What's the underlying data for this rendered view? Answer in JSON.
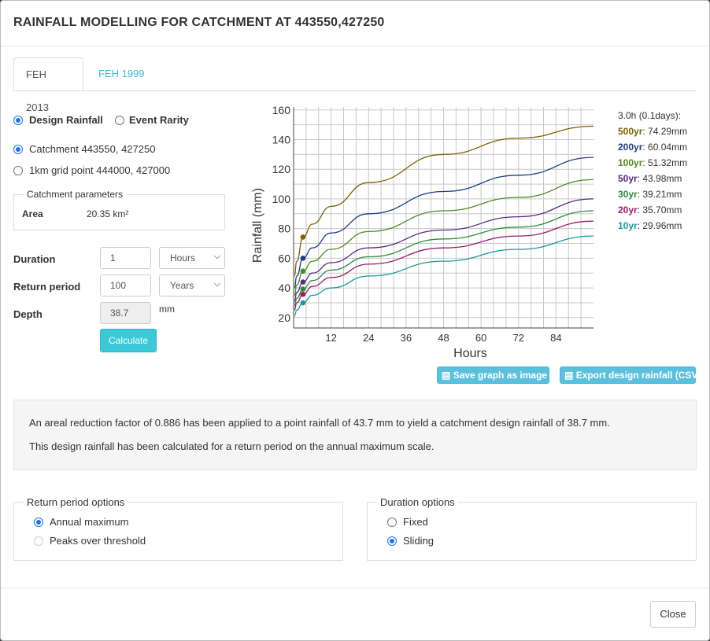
{
  "title": "RAINFALL MODELLING FOR CATCHMENT AT 443550,427250",
  "tabs": [
    {
      "label": "FEH 2013",
      "active": true
    },
    {
      "label": "FEH 1999",
      "active": false
    }
  ],
  "mode": {
    "design": "Design Rainfall",
    "event": "Event Rarity",
    "selected": "design"
  },
  "location": {
    "catchment": "Catchment 443550, 427250",
    "grid": "1km grid point 444000, 427000",
    "selected": "catchment"
  },
  "catchment_params": {
    "legend": "Catchment parameters",
    "area_label": "Area",
    "area_value": "20.35 km²"
  },
  "form": {
    "duration_label": "Duration",
    "duration_value": "1",
    "duration_unit": "Hours",
    "return_label": "Return period",
    "return_value": "100",
    "return_unit": "Years",
    "depth_label": "Depth",
    "depth_value": "38.7",
    "depth_unit": "mm",
    "calculate": "Calculate"
  },
  "buttons": {
    "save_graph": "Save graph as image",
    "export": "Export design rainfall (CSV)",
    "close": "Close"
  },
  "info": {
    "line1": "An areal reduction factor of 0.886 has been applied to a point rainfall of 43.7 mm to yield a catchment design rainfall of 38.7 mm.",
    "line2": "This design rainfall has been calculated for a return period on the annual maximum scale."
  },
  "return_options": {
    "legend": "Return period options",
    "opt1": "Annual maximum",
    "opt2": "Peaks over threshold",
    "selected": "opt1"
  },
  "duration_options": {
    "legend": "Duration options",
    "opt1": "Fixed",
    "opt2": "Sliding",
    "selected": "opt2"
  },
  "chart_data": {
    "type": "line",
    "xlabel": "Hours",
    "ylabel": "Rainfall (mm)",
    "xlim": [
      0,
      96
    ],
    "ylim": [
      13,
      162
    ],
    "x_ticks": [
      12,
      24,
      36,
      48,
      60,
      72,
      84
    ],
    "y_ticks": [
      20,
      40,
      60,
      80,
      100,
      120,
      140,
      160
    ],
    "grid": true,
    "marker_x": 3,
    "legend_header": "3.0h (0.1days):",
    "legend_position": "right",
    "series": [
      {
        "name": "500yr",
        "value_label": "74.29mm",
        "color": "#7f6000",
        "x": [
          0.25,
          1,
          3,
          6,
          12,
          24,
          48,
          72,
          96
        ],
        "values": [
          48,
          58,
          74.29,
          83,
          95,
          111,
          130,
          141,
          149
        ]
      },
      {
        "name": "200yr",
        "value_label": "60.04mm",
        "color": "#1f3a8a",
        "x": [
          0.25,
          1,
          3,
          6,
          12,
          24,
          48,
          72,
          96
        ],
        "values": [
          40,
          48,
          60.04,
          67,
          77,
          90,
          105,
          116,
          128
        ]
      },
      {
        "name": "100yr",
        "value_label": "51.32mm",
        "color": "#4e8c1e",
        "x": [
          0.25,
          1,
          3,
          6,
          12,
          24,
          48,
          72,
          96
        ],
        "values": [
          35,
          42,
          51.32,
          58,
          66,
          78,
          92,
          101,
          113
        ]
      },
      {
        "name": "50yr",
        "value_label": "43.98mm",
        "color": "#5b2a86",
        "x": [
          0.25,
          1,
          3,
          6,
          12,
          24,
          48,
          72,
          96
        ],
        "values": [
          31,
          37,
          43.98,
          50,
          57,
          67,
          79,
          88,
          100
        ]
      },
      {
        "name": "30yr",
        "value_label": "39.21mm",
        "color": "#2e8b3e",
        "x": [
          0.25,
          1,
          3,
          6,
          12,
          24,
          48,
          72,
          96
        ],
        "values": [
          28,
          33,
          39.21,
          45,
          52,
          61,
          73,
          81,
          92
        ]
      },
      {
        "name": "20yr",
        "value_label": "35.70mm",
        "color": "#9b1b6b",
        "x": [
          0.25,
          1,
          3,
          6,
          12,
          24,
          48,
          72,
          96
        ],
        "values": [
          25,
          30,
          35.7,
          41,
          47,
          56,
          67,
          75,
          85
        ]
      },
      {
        "name": "10yr",
        "value_label": "29.96mm",
        "color": "#1a9a9a",
        "x": [
          0.25,
          1,
          3,
          6,
          12,
          24,
          48,
          72,
          96
        ],
        "values": [
          21,
          25,
          29.96,
          35,
          40,
          48,
          58,
          66,
          75
        ]
      }
    ]
  }
}
